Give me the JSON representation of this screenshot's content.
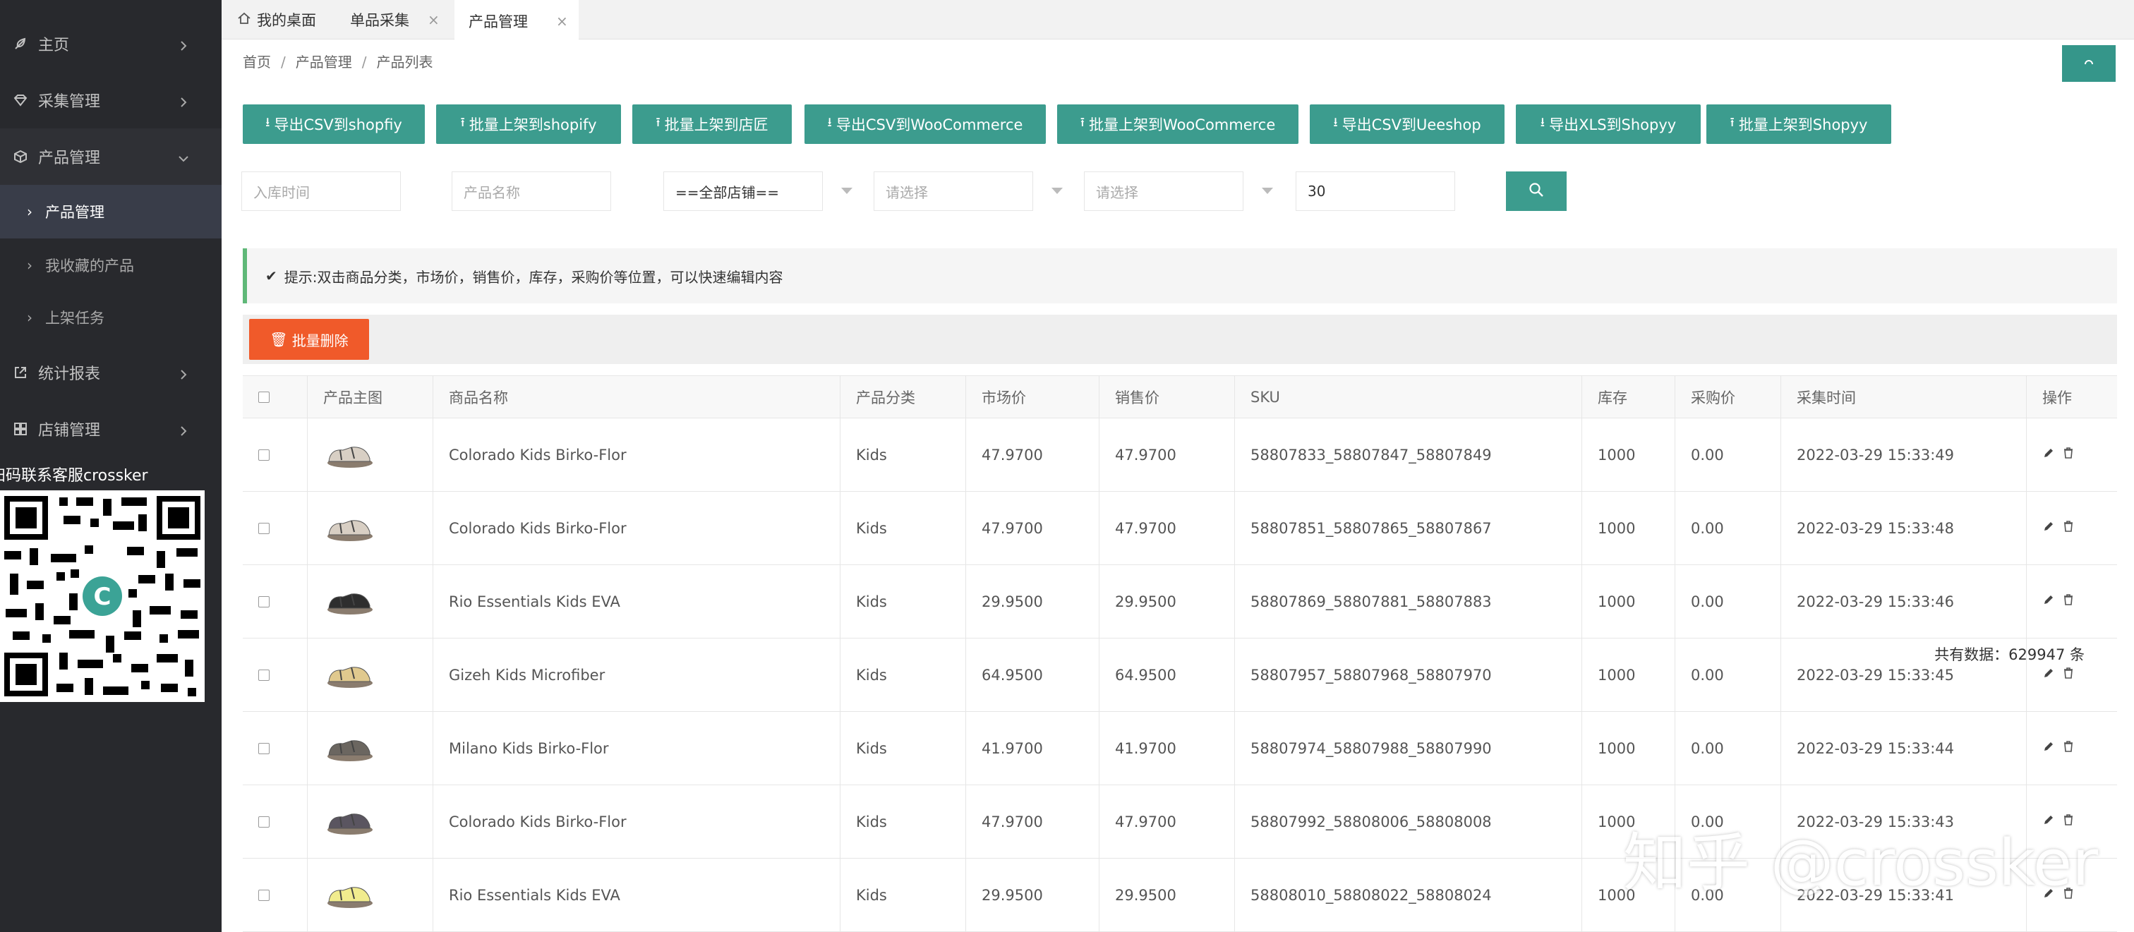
{
  "sidebar": {
    "items": [
      {
        "label": "主页",
        "icon": "leaf-icon"
      },
      {
        "label": "采集管理",
        "icon": "diamond-icon"
      },
      {
        "label": "产品管理",
        "icon": "cube-icon"
      },
      {
        "label": "统计报表",
        "icon": "external-link-icon"
      },
      {
        "label": "店铺管理",
        "icon": "grid-icon"
      }
    ],
    "subitems": [
      {
        "label": "产品管理",
        "active": true
      },
      {
        "label": "我收藏的产品",
        "active": false
      },
      {
        "label": "上架任务",
        "active": false
      }
    ],
    "qr_label": "扫码联系客服crossker"
  },
  "tabs": [
    {
      "label": "我的桌面"
    },
    {
      "label": "单品采集"
    },
    {
      "label": "产品管理"
    }
  ],
  "breadcrumb": [
    "首页",
    "产品管理",
    "产品列表"
  ],
  "toolbar_buttons": [
    "导出CSV到shopfiy",
    "批量上架到shopify",
    "批量上架到店匠",
    "导出CSV到WooCommerce",
    "批量上架到WooCommerce",
    "导出CSV到Ueeshop",
    "导出XLS到Shopyy",
    "批量上架到Shopyy"
  ],
  "filters": {
    "date_placeholder": "入库时间",
    "name_placeholder": "产品名称",
    "store_value": "==全部店铺==",
    "select1_placeholder": "请选择",
    "select2_placeholder": "请选择",
    "page_size": "30"
  },
  "tip": "提示:双击商品分类，市场价，销售价，库存，采购价等位置，可以快速编辑内容",
  "batch_delete": "批量删除",
  "total": "共有数据：629947 条",
  "table": {
    "headers": [
      "产品主图",
      "商品名称",
      "产品分类",
      "市场价",
      "销售价",
      "SKU",
      "库存",
      "采购价",
      "采集时间",
      "操作"
    ],
    "rows": [
      {
        "name": "Colorado Kids Birko-Flor",
        "category": "Kids",
        "market": "47.9700",
        "sale": "47.9700",
        "sku": "58807833_58807847_58807849",
        "stock": "1000",
        "cost": "0.00",
        "time": "2022-03-29 15:33:49"
      },
      {
        "name": "Colorado Kids Birko-Flor",
        "category": "Kids",
        "market": "47.9700",
        "sale": "47.9700",
        "sku": "58807851_58807865_58807867",
        "stock": "1000",
        "cost": "0.00",
        "time": "2022-03-29 15:33:48"
      },
      {
        "name": "Rio Essentials Kids EVA",
        "category": "Kids",
        "market": "29.9500",
        "sale": "29.9500",
        "sku": "58807869_58807881_58807883",
        "stock": "1000",
        "cost": "0.00",
        "time": "2022-03-29 15:33:46"
      },
      {
        "name": "Gizeh Kids Microfiber",
        "category": "Kids",
        "market": "64.9500",
        "sale": "64.9500",
        "sku": "58807957_58807968_58807970",
        "stock": "1000",
        "cost": "0.00",
        "time": "2022-03-29 15:33:45"
      },
      {
        "name": "Milano Kids Birko-Flor",
        "category": "Kids",
        "market": "41.9700",
        "sale": "41.9700",
        "sku": "58807974_58807988_58807990",
        "stock": "1000",
        "cost": "0.00",
        "time": "2022-03-29 15:33:44"
      },
      {
        "name": "Colorado Kids Birko-Flor",
        "category": "Kids",
        "market": "47.9700",
        "sale": "47.9700",
        "sku": "58807992_58808006_58808008",
        "stock": "1000",
        "cost": "0.00",
        "time": "2022-03-29 15:33:43"
      },
      {
        "name": "Rio Essentials Kids EVA",
        "category": "Kids",
        "market": "29.9500",
        "sale": "29.9500",
        "sku": "58808010_58808022_58808024",
        "stock": "1000",
        "cost": "0.00",
        "time": "2022-03-29 15:33:41"
      }
    ]
  },
  "shoe_colors": [
    "#d8cfc4",
    "#d8cfc4",
    "#2e2e2e",
    "#e0c98e",
    "#6b6660",
    "#5a5560",
    "#f1ec8e"
  ],
  "watermark": "知乎 @crossker",
  "colors": {
    "accent": "#3c9c8e",
    "danger": "#f05a2a",
    "sidebar": "#28292d",
    "tip_border": "#5fb878"
  }
}
